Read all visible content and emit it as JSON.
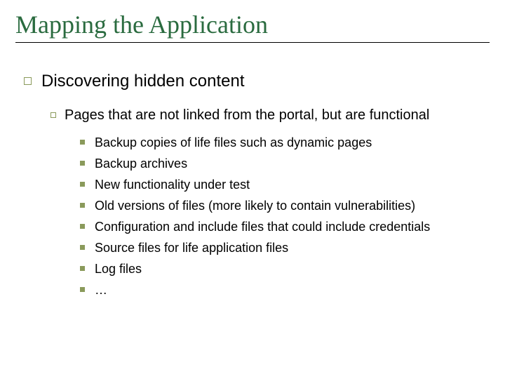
{
  "title": "Mapping the Application",
  "level1": {
    "text": "Discovering hidden content"
  },
  "level2": {
    "text": "Pages that are not linked from the portal, but are functional"
  },
  "level3": [
    {
      "text": "Backup copies of life files such as dynamic pages"
    },
    {
      "text": "Backup archives"
    },
    {
      "text": "New functionality under test"
    },
    {
      "text": "Old versions of files (more likely to contain vulnerabilities)"
    },
    {
      "text": "Configuration and include files that could include credentials"
    },
    {
      "text": "Source files for life application files"
    },
    {
      "text": "Log files"
    },
    {
      "text": "…"
    }
  ],
  "colors": {
    "title": "#2a6b3f",
    "bullet": "#8a9a5b"
  }
}
